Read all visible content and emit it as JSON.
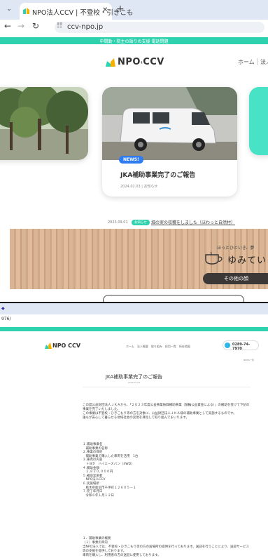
{
  "browser": {
    "tab_title": "NPO法人CCV | 不登校・引きこも",
    "new_tab": "+",
    "url": "ccv-npo.jp"
  },
  "site": {
    "top_banner": "中間勤・院主の語りの支援 電話問題 ",
    "logo": "NPO",
    "logo_bold": "CCV",
    "nav_home": "ホーム",
    "nav_more": "法人"
  },
  "news_card": {
    "badge": "NEWS!",
    "title": "JKA補助事業完了のご報告",
    "date": "2024.02.03 | お知らせ"
  },
  "news_list": {
    "date": "2023.09.01",
    "badge": "お知らせ",
    "link": "畑の実の収穫をしました（ほわっと自然村）"
  },
  "yumitei": {
    "catch": "ほっとひといき、夢",
    "name": "ゆみてい",
    "button": "その他の顔"
  },
  "second": {
    "url_partial": "976/",
    "nav": "ホーム　法人概要　取り組み　採用一覧　所在地図",
    "phone": "0289-74-7970",
    "small_link": "NEWS一覧",
    "title": "JKA補助事業完了のご報告",
    "subtitle": "2024.02.03",
    "intro": [
      "この度公益財団法人ＪＫＡから、「２０２３年度公益事業振興補助事業（競輪公益資金による）」の補助を受けて下記の事業を完了いたしました。",
      "この事業は不登校・ひきこもり等の方を対象に、公益財団法人ＪＫＡ様の補助事業として実施するものです。",
      "誰もが安心して暮らせる地域社会の実現を目指して取り組んでまいります。"
    ],
    "details": [
      "１.補助事業名",
      "　補助事業の名称",
      "２.事業の目的",
      "　補助事業で購入した車両を活用　1台",
      "３.車両の内容",
      "　トヨタ　ハイエースバン（4WD）",
      "４.補助金額",
      "　２,８２０,０００円",
      "５.補助実施者",
      "　NPO法人CCV",
      "６.実施場所",
      "　栃木県鹿沼市千手町１２６０５－１",
      "７.完了年月日",
      "　令和６年１月１２日"
    ],
    "outro": [
      "１．補助事業の概要",
      "（１）事業の目的",
      "当NPO法人では、不登校・ひきこもり等の方の居場所の提供を行っております。送迎を行うことにより、送迎サービス等の支援を提供しております。",
      "車両を購入し、利用者の方の送迎に使用しております。"
    ]
  }
}
